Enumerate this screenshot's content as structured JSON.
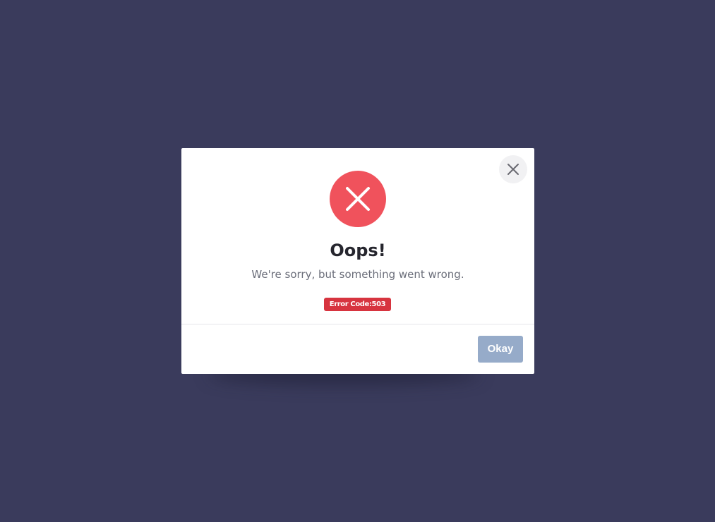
{
  "dialog": {
    "title": "Oops!",
    "message": "We're sorry, but something went wrong.",
    "error_badge": "Error Code:503",
    "okay_label": "Okay"
  },
  "icons": {
    "status": "error-x-icon",
    "close": "close-icon"
  },
  "colors": {
    "backdrop": "#3a3b5c",
    "error": "#f0525c",
    "badge": "#d7343f",
    "okay_button": "#96abc9"
  }
}
